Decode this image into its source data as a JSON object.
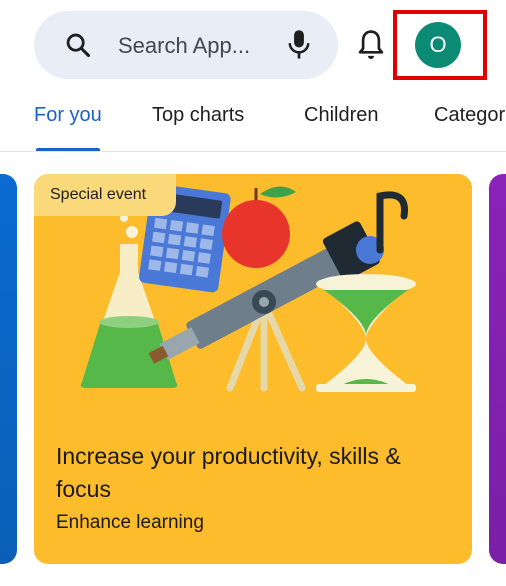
{
  "search": {
    "placeholder": "Search App..."
  },
  "account": {
    "initial": "O"
  },
  "tabs": [
    {
      "label": "For you",
      "active": true
    },
    {
      "label": "Top charts",
      "active": false
    },
    {
      "label": "Children",
      "active": false
    },
    {
      "label": "Categor",
      "active": false
    }
  ],
  "featured": {
    "badge": "Special event",
    "title": "Increase your productivity, skills & focus",
    "subtitle": "Enhance learning"
  },
  "colors": {
    "accent": "#1a63c4",
    "card_bg": "#fcbc2b",
    "avatar_bg": "#0b8b73",
    "highlight_border": "#e00000"
  },
  "icons": [
    "search-icon",
    "mic-icon",
    "bell-icon"
  ]
}
